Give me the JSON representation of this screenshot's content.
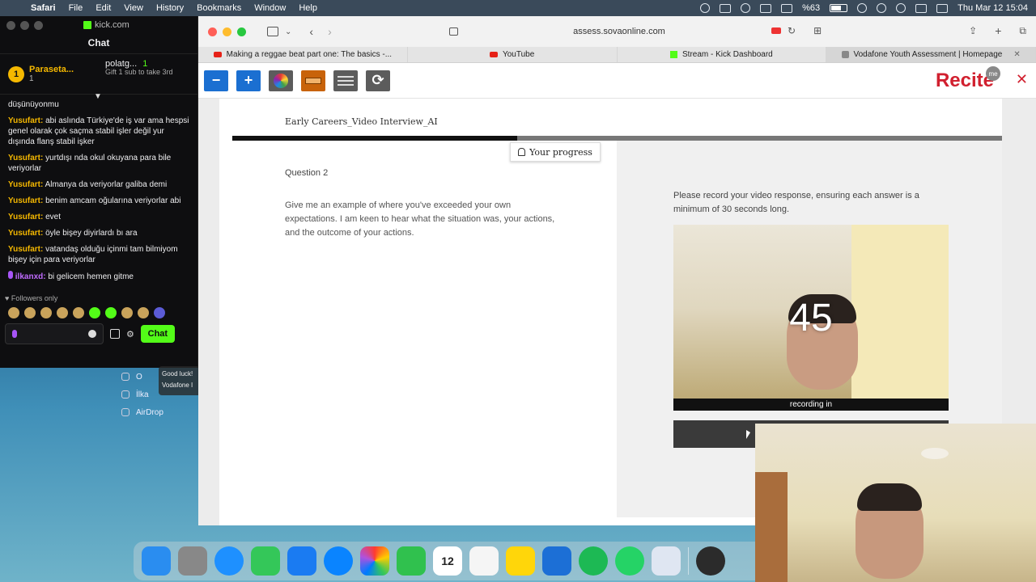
{
  "menubar": {
    "app": "Safari",
    "items": [
      "File",
      "Edit",
      "View",
      "History",
      "Bookmarks",
      "Window",
      "Help"
    ],
    "battery": "%63",
    "datetime": "Thu Mar 12  15:04"
  },
  "kick": {
    "site": "kick.com",
    "header": "Chat",
    "pinned_left_name": "Paraseta...",
    "pinned_left_count": "1",
    "pinned_rank": "1",
    "pinned_right_name": "polatg...",
    "pinned_right_count": "1",
    "pinned_right_sub": "Gift 1 sub to take 3rd",
    "messages": [
      {
        "user": "",
        "text": "düşünüyonmu"
      },
      {
        "user": "Yusufart:",
        "text": "abi aslında Türkiye'de iş var ama hespsi genel olarak çok saçma stabil işler değil yur dışında flanş stabil işker"
      },
      {
        "user": "Yusufart:",
        "text": "yurtdışı nda okul okuyana para bile veriyorlar"
      },
      {
        "user": "Yusufart:",
        "text": "Almanya da veriyorlar galiba demi"
      },
      {
        "user": "Yusufart:",
        "text": "benim amcam oğularına veriyorlar abi"
      },
      {
        "user": "Yusufart:",
        "text": "evet"
      },
      {
        "user": "Yusufart:",
        "text": "öyle bişey diyirlardı bı ara"
      },
      {
        "user": "Yusufart:",
        "text": "vatandaş olduğu içinmi tam bilmiyom bişey için para veriyorlar"
      },
      {
        "user": "ilkanxd:",
        "text": "bi gelicem hemen gitme"
      }
    ],
    "followers_only": "Followers only",
    "chat_button": "Chat"
  },
  "finder": {
    "item1": "O",
    "item2": "İlka",
    "airdrop": "AirDrop",
    "notif_line1": "Good luck!",
    "notif_line2": "Vodafone I"
  },
  "safari": {
    "url": "assess.sovaonline.com",
    "tabs": [
      {
        "label": "Making a reggae beat part one: The basics -...",
        "icon": "youtube-icon"
      },
      {
        "label": "YouTube",
        "icon": "youtube-icon"
      },
      {
        "label": "Stream - Kick Dashboard",
        "icon": "kick-icon"
      },
      {
        "label": "Vodafone Youth Assessment | Homepage",
        "icon": "vodafone-icon"
      }
    ]
  },
  "recite": {
    "logo": "Recite",
    "badge": "me"
  },
  "assessment": {
    "title": "Early Careers_Video Interview_AI",
    "progress_label": "Your progress",
    "progress_fraction": 0.37,
    "question_label": "Question 2",
    "question_text": "Give me an example of where you've exceeded your own expectations. I am keen to hear what the situation was, your actions, and the outcome of your actions.",
    "instructions": "Please record your video response, ensuring each answer is a minimum of 30 seconds long.",
    "countdown": "45",
    "recording_caption": "recording in"
  },
  "dock": {
    "calendar_day": "12"
  }
}
